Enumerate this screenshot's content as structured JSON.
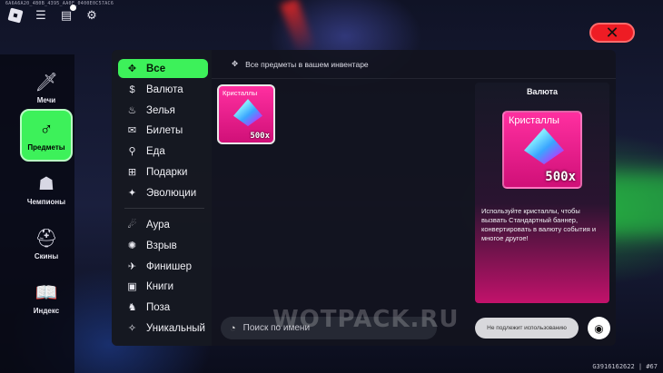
{
  "top": {
    "session_id": "6A6A6A20_4B0B_4395_AA0F_0400E0C57AC6"
  },
  "nav": {
    "items": [
      {
        "label": "Мечи",
        "icon": "sword-icon",
        "glyph": "🗡"
      },
      {
        "label": "Предметы",
        "icon": "bag-icon",
        "glyph": "♂"
      },
      {
        "label": "Чемпионы",
        "icon": "champion-icon",
        "glyph": "☗"
      },
      {
        "label": "Скины",
        "icon": "helmet-icon",
        "glyph": "⛑"
      },
      {
        "label": "Индекс",
        "icon": "book-icon",
        "glyph": "📖"
      }
    ]
  },
  "close": {
    "glyph": "✕"
  },
  "categories": {
    "group1": [
      {
        "label": "Все",
        "icon": "grid-icon",
        "glyph": "✥"
      },
      {
        "label": "Валюта",
        "icon": "dollar-icon",
        "glyph": "$"
      },
      {
        "label": "Зелья",
        "icon": "potion-icon",
        "glyph": "♨"
      },
      {
        "label": "Билеты",
        "icon": "ticket-icon",
        "glyph": "✉"
      },
      {
        "label": "Еда",
        "icon": "food-icon",
        "glyph": "⚲"
      },
      {
        "label": "Подарки",
        "icon": "gift-icon",
        "glyph": "⊞"
      },
      {
        "label": "Эволюции",
        "icon": "sparkle-icon",
        "glyph": "✦"
      }
    ],
    "group2": [
      {
        "label": "Аура",
        "icon": "aura-icon",
        "glyph": "☄"
      },
      {
        "label": "Взрыв",
        "icon": "explosion-icon",
        "glyph": "✺"
      },
      {
        "label": "Финишер",
        "icon": "finisher-icon",
        "glyph": "✈"
      },
      {
        "label": "Книги",
        "icon": "books-icon",
        "glyph": "▣"
      },
      {
        "label": "Поза",
        "icon": "pose-icon",
        "glyph": "♞"
      },
      {
        "label": "Уникальный",
        "icon": "unique-icon",
        "glyph": "✧"
      }
    ]
  },
  "header": {
    "text": "Все предметы в вашем инвентаре",
    "icon_glyph": "✥"
  },
  "items": [
    {
      "name": "Кристаллы",
      "qty": "500x"
    }
  ],
  "detail": {
    "category": "Валюта",
    "name": "Кристаллы",
    "qty": "500x",
    "description": "Используйте кристаллы, чтобы вызвать Стандартный баннер, конвертировать в валюту события и многое другое!"
  },
  "bottom": {
    "search_placeholder": "Поиск по имени",
    "unusable_label": "Не подлежит использованию",
    "eye_glyph": "◉"
  },
  "watermark": "WOTPACK.RU",
  "footer_id": "G3916162622 | #67",
  "colors": {
    "accent": "#3df15a",
    "close": "#ee1c24",
    "card_pink": "#ff2fa0"
  }
}
